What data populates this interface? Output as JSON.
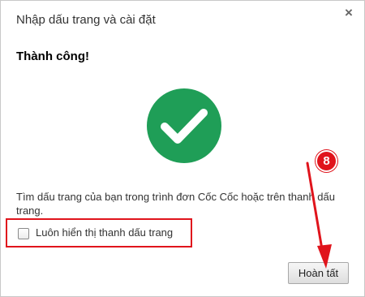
{
  "dialog": {
    "title": "Nhập dấu trang và cài đặt",
    "close_glyph": "×",
    "success_heading": "Thành công!",
    "success_icon": "check-icon",
    "success_color": "#1f9e57",
    "description": "Tìm dấu trang của bạn trong trình đơn Cốc Cốc hoặc trên thanh dấu trang.",
    "checkbox": {
      "label": "Luôn hiển thị thanh dấu trang",
      "checked": false
    },
    "done_label": "Hoàn tất"
  },
  "annotation": {
    "step_number": "8",
    "color": "#e0141c"
  }
}
